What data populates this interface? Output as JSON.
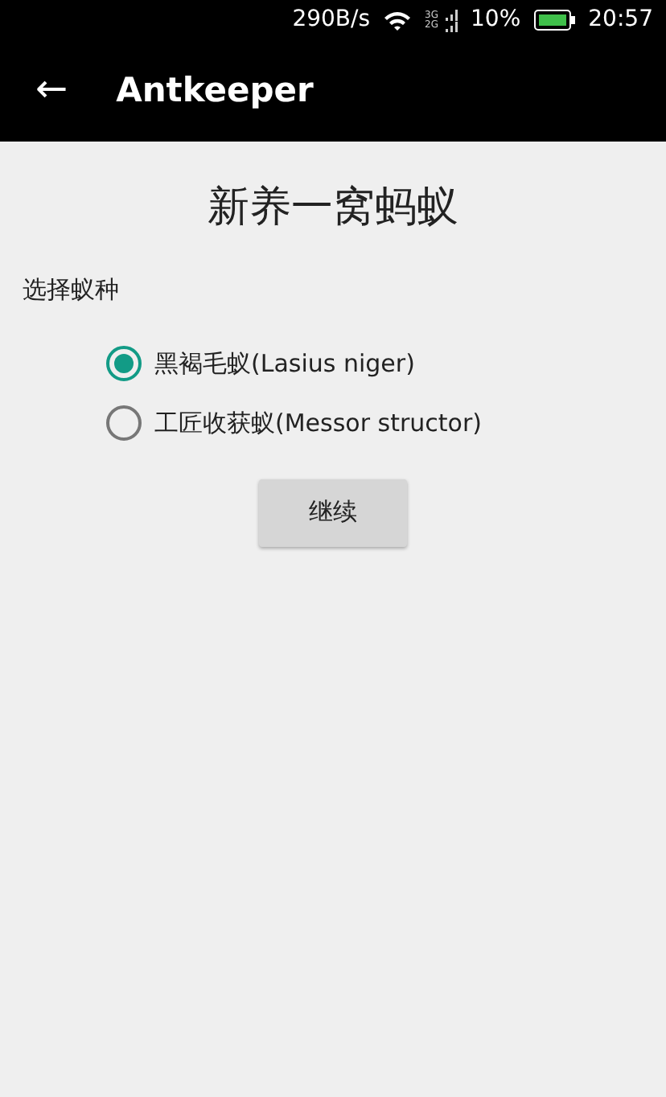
{
  "status_bar": {
    "speed": "290B/s",
    "network_labels": [
      "3G",
      "2G"
    ],
    "battery": "10%",
    "time": "20:57"
  },
  "app_bar": {
    "back": "←",
    "title": "Antkeeper"
  },
  "heading": "新养一窝蚂蚁",
  "species_label": "选择蚁种",
  "options": [
    {
      "label": "黑褐毛蚁(Lasius niger)",
      "selected": true
    },
    {
      "label": "工匠收获蚁(Messor structor)",
      "selected": false
    }
  ],
  "button": "继续"
}
